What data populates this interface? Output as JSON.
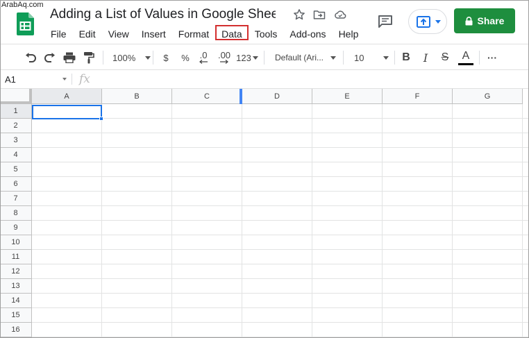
{
  "watermark": "ArabAq.com",
  "document": {
    "title": "Adding a List of Values in Google Shee..."
  },
  "menu": [
    {
      "label": "File"
    },
    {
      "label": "Edit"
    },
    {
      "label": "View"
    },
    {
      "label": "Insert"
    },
    {
      "label": "Format"
    },
    {
      "label": "Data",
      "highlighted": true
    },
    {
      "label": "Tools"
    },
    {
      "label": "Add-ons"
    },
    {
      "label": "Help"
    }
  ],
  "share": {
    "label": "Share"
  },
  "toolbar": {
    "zoom": "100%",
    "currency": "$",
    "percent": "%",
    "decrease_decimals": ".0",
    "increase_decimals": ".00",
    "more_formats": "123",
    "font": "Default (Ari...",
    "font_size": "10",
    "bold": "B",
    "italic": "I",
    "strikethrough": "S",
    "text_color": "A",
    "more": "···"
  },
  "formula_bar": {
    "cell_ref": "A1",
    "fx": "fx"
  },
  "grid": {
    "columns": [
      "A",
      "B",
      "C",
      "D",
      "E",
      "F",
      "G"
    ],
    "rows": [
      "1",
      "2",
      "3",
      "4",
      "5",
      "6",
      "7",
      "8",
      "9",
      "10",
      "11",
      "12",
      "13",
      "14",
      "15",
      "16"
    ],
    "selected_cell": "A1"
  },
  "colors": {
    "accent": "#1a73e8",
    "share_bg": "#1e8e3e",
    "highlight_box": "#d32f2f"
  }
}
